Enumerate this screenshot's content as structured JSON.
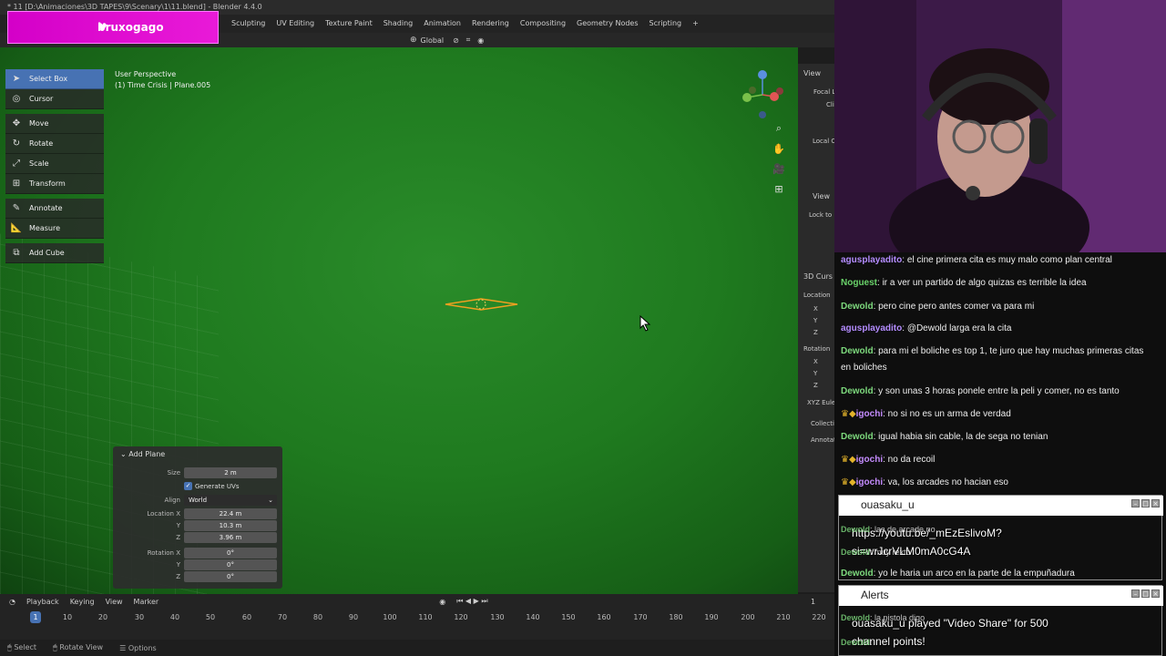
{
  "window": {
    "title": "* 11 [D:\\Animaciones\\3D TAPES\\9\\Scenary\\1\\11.blend] - Blender 4.4.0"
  },
  "menubar": {
    "workspaces": [
      "Sculpting",
      "UV Editing",
      "Texture Paint",
      "Shading",
      "Animation",
      "Rendering",
      "Compositing",
      "Geometry Nodes",
      "Scripting",
      "+"
    ]
  },
  "header": {
    "orientation": "Global"
  },
  "overlay": {
    "channel_name": "bruxogago"
  },
  "viewport": {
    "perspective": "User Perspective",
    "object_info": "(1) Time Crisis | Plane.005"
  },
  "toolbar": {
    "tools": [
      {
        "label": "Select Box",
        "icon": "select-box-icon"
      },
      {
        "label": "Cursor",
        "icon": "cursor-icon"
      },
      {
        "label": "Move",
        "icon": "move-icon"
      },
      {
        "label": "Rotate",
        "icon": "rotate-icon"
      },
      {
        "label": "Scale",
        "icon": "scale-icon"
      },
      {
        "label": "Transform",
        "icon": "transform-icon"
      },
      {
        "label": "Annotate",
        "icon": "annotate-icon"
      },
      {
        "label": "Measure",
        "icon": "measure-icon"
      },
      {
        "label": "Add Cube",
        "icon": "add-cube-icon"
      }
    ]
  },
  "sidebar": {
    "view_tab": "View",
    "focal": "Focal L",
    "clip": "Cli",
    "local_camera": "Local C",
    "view_section": "View",
    "lock_to": "Lock to",
    "cursor_section": "3D Curs",
    "location": "Location",
    "x": "X",
    "y": "Y",
    "z": "Z",
    "rotation": "Rotation",
    "rotation_mode": "XYZ Eule",
    "collection": "Collecti",
    "annotations": "Annotat"
  },
  "operator_panel": {
    "title": "Add Plane",
    "size_label": "Size",
    "size_value": "2 m",
    "generate_uvs": "Generate UVs",
    "align_label": "Align",
    "align_value": "World",
    "location_x_label": "Location X",
    "location_x": "22.4 m",
    "location_y_label": "Y",
    "location_y": "10.3 m",
    "location_z_label": "Z",
    "location_z": "3.96 m",
    "rotation_x_label": "Rotation X",
    "rotation_x": "0°",
    "rotation_y_label": "Y",
    "rotation_y": "0°",
    "rotation_z_label": "Z",
    "rotation_z": "0°"
  },
  "timeline": {
    "menus": [
      "Playback",
      "Keying",
      "View",
      "Marker"
    ],
    "current_frame": "1",
    "frame_field": "1",
    "ticks": [
      "10",
      "20",
      "30",
      "40",
      "50",
      "60",
      "70",
      "80",
      "90",
      "100",
      "110",
      "120",
      "130",
      "140",
      "150",
      "160",
      "170",
      "180",
      "190",
      "200",
      "210",
      "220"
    ]
  },
  "statusbar": {
    "select": "Select",
    "rotate_view": "Rotate View",
    "options": "Options"
  },
  "chat": {
    "messages": [
      {
        "user": "agusplayadito",
        "color": "#b48cff",
        "text": "el cine primera cita es muy malo como plan central"
      },
      {
        "user": "Noguest",
        "color": "#6ad36a",
        "text": "ir a ver un partido de algo quizas es terrible la idea"
      },
      {
        "user": "Dewold",
        "color": "#7dd97d",
        "text": "pero cine pero antes comer va para mi"
      },
      {
        "user": "agusplayadito",
        "color": "#b48cff",
        "text": "@Dewold larga era la cita"
      },
      {
        "user": "Dewold",
        "color": "#7dd97d",
        "text": "para mi el boliche es top 1, te juro que hay muchas primeras citas en boliches"
      },
      {
        "user": "Dewold",
        "color": "#7dd97d",
        "text": "y son unas 3 horas ponele entre la peli y comer, no es tanto"
      },
      {
        "user": "igochi",
        "color": "#c58cff",
        "text": "no si no es un arma de verdad"
      },
      {
        "user": "Dewold",
        "color": "#7dd97d",
        "text": "igual habia sin cable, la de sega no tenian"
      },
      {
        "user": "igochi",
        "color": "#c58cff",
        "text": "no da recoil"
      },
      {
        "user": "igochi",
        "color": "#c58cff",
        "text": "va, los arcades no hacian eso"
      },
      {
        "user": "Dewold",
        "color": "#7dd97d",
        "text": "las de arcade no"
      },
      {
        "user": "Dewold",
        "color": "#7dd97d",
        "text": "muy rexto"
      },
      {
        "user": "Dewold",
        "color": "#7dd97d",
        "text": "yo le haria un arco en la parte de la empuñadura"
      },
      {
        "user": "Dewold",
        "color": "#7dd97d",
        "text": "la pistola digo"
      },
      {
        "user": "Dewold",
        "color": "#7dd97d",
        "text": ""
      }
    ]
  },
  "alerts": [
    {
      "title": "ouasaku_u",
      "line1": "https://youtu.be/_mEzEslivoM?",
      "line2": "si=wrJcrVLM0mA0cG4A"
    },
    {
      "title": "Alerts",
      "line1": "ouasaku_u played \"Video Share\" for 500",
      "line2": "channel points!"
    }
  ]
}
